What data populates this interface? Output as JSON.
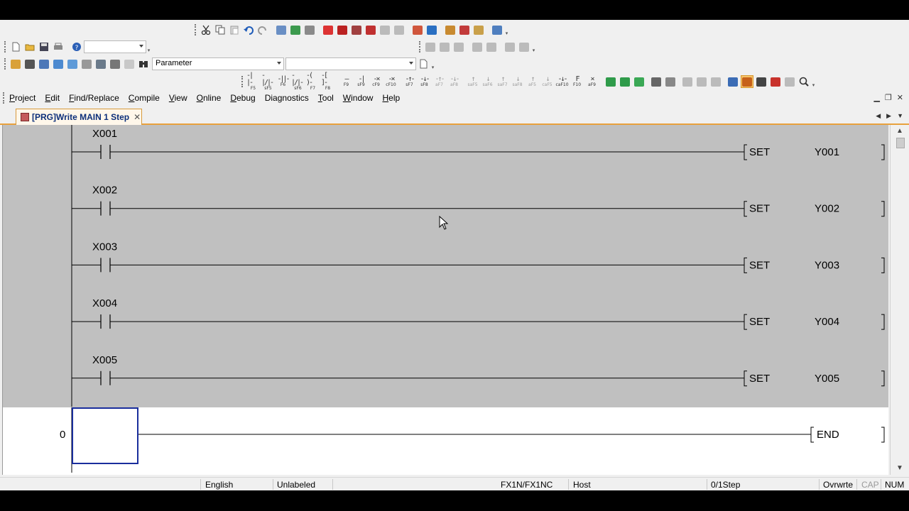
{
  "toolbar2": {
    "combo_value": ""
  },
  "toolbar3": {
    "parameter_combo": "Parameter",
    "second_combo": ""
  },
  "menu": [
    "Project",
    "Edit",
    "Find/Replace",
    "Compile",
    "View",
    "Online",
    "Debug",
    "Diagnostics",
    "Tool",
    "Window",
    "Help"
  ],
  "menu_mnemonic": [
    "P",
    "E",
    "F",
    "C",
    "V",
    "O",
    "D",
    "g",
    "T",
    "W",
    "H"
  ],
  "tab": {
    "title": "[PRG]Write MAIN 1 Step"
  },
  "ladder": {
    "rungs": [
      {
        "contact": "X001",
        "instruction": "SET",
        "device": "Y001"
      },
      {
        "contact": "X002",
        "instruction": "SET",
        "device": "Y002"
      },
      {
        "contact": "X003",
        "instruction": "SET",
        "device": "Y003"
      },
      {
        "contact": "X004",
        "instruction": "SET",
        "device": "Y004"
      },
      {
        "contact": "X005",
        "instruction": "SET",
        "device": "Y005"
      }
    ],
    "end_step": "0",
    "end_label": "END"
  },
  "ladder_keys": [
    "F5",
    "sF5",
    "F6",
    "sF6",
    "F7",
    "F8",
    "F9",
    "sF9",
    "cF9",
    "cF10",
    "sF7",
    "sF8",
    "aF7",
    "aF8",
    "saF5",
    "saF6",
    "saF7",
    "saF8",
    "aF5",
    "caF5",
    "caF10",
    "F10",
    "aF9"
  ],
  "status": {
    "language": "English",
    "label": "Unlabeled",
    "cpu": "FX1N/FX1NC",
    "connection": "Host",
    "steps": "0/1Step",
    "mode": "Ovrwrte",
    "cap": "CAP",
    "num": "NUM"
  },
  "colors": {
    "editor_bg": "#c0c0c0",
    "tab_text": "#0c2f7a",
    "tab_accent": "#e8a13c",
    "cursor_box": "#1a2e9c"
  }
}
